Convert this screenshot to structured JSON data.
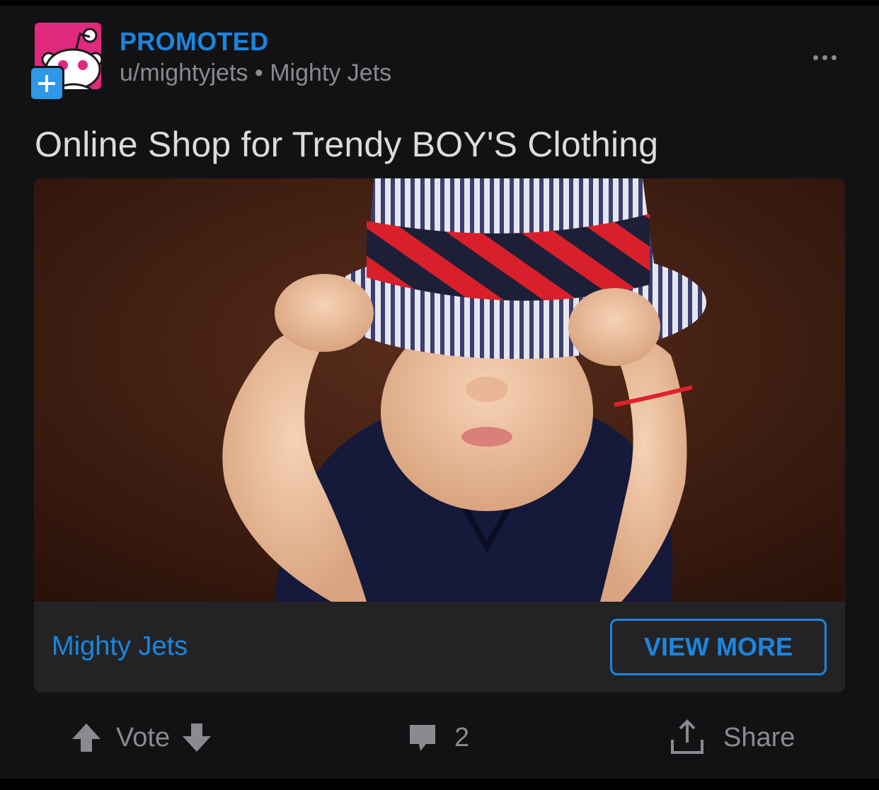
{
  "post": {
    "promoted_label": "PROMOTED",
    "username": "u/mightyjets",
    "separator": "•",
    "advertiser_name": "Mighty Jets",
    "title": "Online Shop for Trendy BOY'S Clothing"
  },
  "ad_card": {
    "advertiser_link": "Mighty Jets",
    "cta_label": "VIEW MORE",
    "image_description": "baby-in-striped-fedora-photo"
  },
  "actions": {
    "vote_label": "Vote",
    "comment_count": "2",
    "share_label": "Share"
  },
  "icons": {
    "avatar": "snoo-avatar-icon",
    "join": "plus-icon",
    "menu": "more-options-icon",
    "upvote": "upvote-arrow-icon",
    "downvote": "downvote-arrow-icon",
    "comment": "comment-bubble-icon",
    "share": "share-icon"
  },
  "colors": {
    "background": "#121215",
    "accent_blue": "#1a86e0",
    "muted_text": "#8a8a8f",
    "title_text": "#dcdcdf",
    "avatar_pink": "#e0287d",
    "badge_blue": "#2e97e6",
    "card_footer": "#232326"
  }
}
